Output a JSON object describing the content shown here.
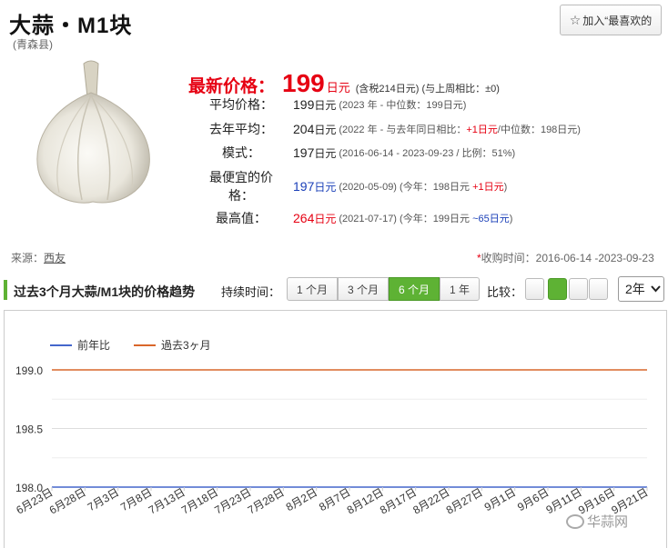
{
  "header": {
    "title": "大蒜・M1块",
    "region": "(青森县)",
    "fav_button": "加入“最喜欢的"
  },
  "price": {
    "latest_label": "最新价格：",
    "latest_value": "199",
    "latest_unit": "日元",
    "latest_note": "(含税214日元) (与上周相比：±0)"
  },
  "rows": [
    {
      "key": "平均价格：",
      "value": "199",
      "unit": "日元",
      "detail_pre": "(2023 年 - 中位数：199日元)",
      "detail_colored": "",
      "detail_post": ""
    },
    {
      "key": "去年平均：",
      "value": "204",
      "unit": "日元",
      "detail_pre": "(2022 年 - 与去年同日相比：",
      "detail_colored": "+1日元",
      "detail_post": "/中位数：198日元)"
    },
    {
      "key": "模式：",
      "value": "197",
      "unit": "日元",
      "detail_pre": "(2016-06-14 - 2023-09-23 / 比例：51%)",
      "detail_colored": "",
      "detail_post": ""
    },
    {
      "key": "最便宜的价格：",
      "value": "197",
      "unit": "日元",
      "detail_pre": "(2020-05-09) (今年：198日元 ",
      "detail_colored": "+1日元",
      "detail_post": ")"
    },
    {
      "key": "最高值：",
      "value": "264",
      "unit": "日元",
      "detail_pre": "(2021-07-17) (今年：199日元 ",
      "detail_colored": "~65日元",
      "detail_post": ")"
    }
  ],
  "source": {
    "label": "来源：",
    "link": "西友"
  },
  "collect": {
    "asterisk": "*",
    "text": "收购时间：2016-06-14 -2023-09-23"
  },
  "trend": {
    "title": "过去3个月大蒜/M1块的价格趋势",
    "duration_label": "持续时间：",
    "durations": [
      "1 个月",
      "3 个月",
      "6 个月",
      "1 年"
    ],
    "active_duration": "6 个月",
    "compare_label": "比较：",
    "year_select": "2年"
  },
  "colors": {
    "accent_green": "#5eb234",
    "price_red": "#e60012",
    "line_blue": "#4466cc",
    "line_orange": "#d9662a"
  },
  "chart_data": {
    "type": "line",
    "x": [
      "6月23日",
      "6月28日",
      "7月3日",
      "7月8日",
      "7月13日",
      "7月18日",
      "7月23日",
      "7月28日",
      "8月2日",
      "8月7日",
      "8月12日",
      "8月17日",
      "8月22日",
      "8月27日",
      "9月1日",
      "9月6日",
      "9月11日",
      "9月16日",
      "9月21日"
    ],
    "series": [
      {
        "name": "前年比",
        "color": "#4466cc",
        "values": [
          198.0,
          198.0,
          198.0,
          198.0,
          198.0,
          198.0,
          198.0,
          198.0,
          198.0,
          198.0,
          198.0,
          198.0,
          198.0,
          198.0,
          198.0,
          198.0,
          198.0,
          198.0,
          198.0
        ]
      },
      {
        "name": "過去3ヶ月",
        "color": "#d9662a",
        "values": [
          199.0,
          199.0,
          199.0,
          199.0,
          199.0,
          199.0,
          199.0,
          199.0,
          199.0,
          199.0,
          199.0,
          199.0,
          199.0,
          199.0,
          199.0,
          199.0,
          199.0,
          199.0,
          199.0
        ]
      }
    ],
    "y_ticks": [
      "199.0",
      "198.5",
      "198.0"
    ],
    "ylim": [
      198.0,
      199.0
    ],
    "grid": true,
    "legend": "top-left"
  },
  "watermark": "华蒜网"
}
